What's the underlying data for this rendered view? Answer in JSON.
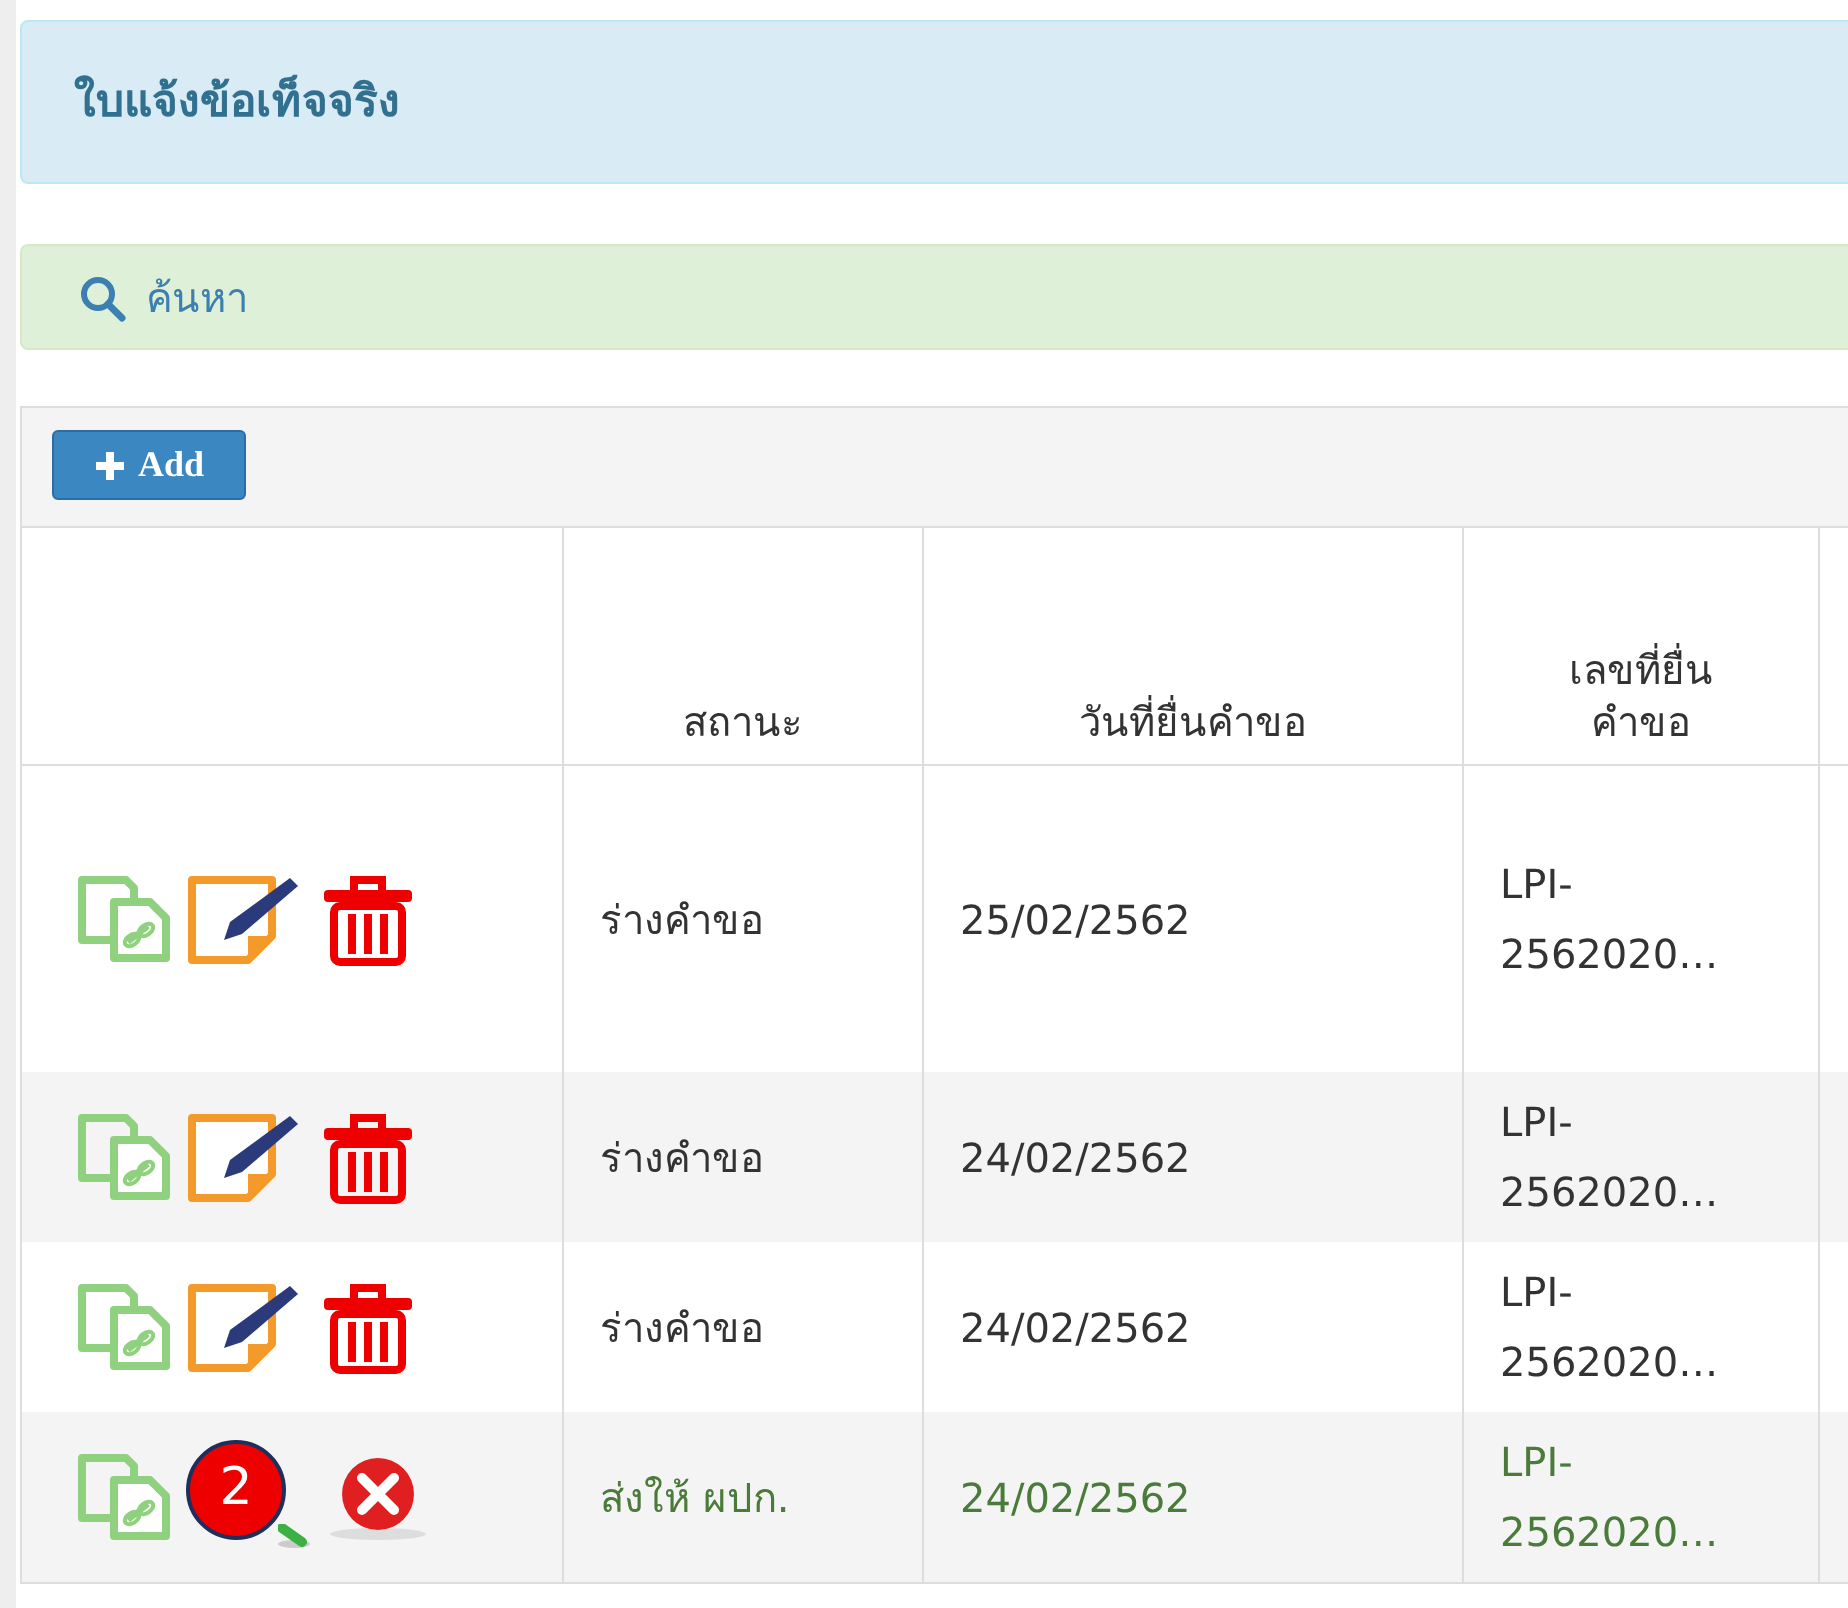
{
  "header": {
    "title": "ใบแจ้งข้อเท็จจริง"
  },
  "search_bar": {
    "label": "ค้นหา"
  },
  "toolbar": {
    "add_button": "Add"
  },
  "table": {
    "columns": [
      "",
      "สถานะ",
      "วันที่ยื่นคำขอ",
      "เลขที่ยื่น คำขอ"
    ],
    "rows": [
      {
        "kind": "draft",
        "actions": [
          {
            "kind": "copy"
          },
          {
            "kind": "edit"
          },
          {
            "kind": "delete"
          }
        ],
        "status": "ร่างคำขอ",
        "date": "25/02/2562",
        "number": "LPI-2562020…"
      },
      {
        "kind": "draft",
        "actions": [
          {
            "kind": "copy"
          },
          {
            "kind": "edit"
          },
          {
            "kind": "delete"
          }
        ],
        "status": "ร่างคำขอ",
        "date": "24/02/2562",
        "number": "LPI-2562020…"
      },
      {
        "kind": "draft",
        "actions": [
          {
            "kind": "copy"
          },
          {
            "kind": "edit"
          },
          {
            "kind": "delete"
          }
        ],
        "status": "ร่างคำขอ",
        "date": "24/02/2562",
        "number": "LPI-2562020…"
      },
      {
        "kind": "sent",
        "actions": [
          {
            "kind": "copy"
          },
          {
            "kind": "view"
          },
          {
            "kind": "cancel"
          }
        ],
        "badge": "2",
        "status": "ส่งให้ ผปก.",
        "date": "24/02/2562",
        "number": "LPI-2562020…"
      }
    ]
  }
}
